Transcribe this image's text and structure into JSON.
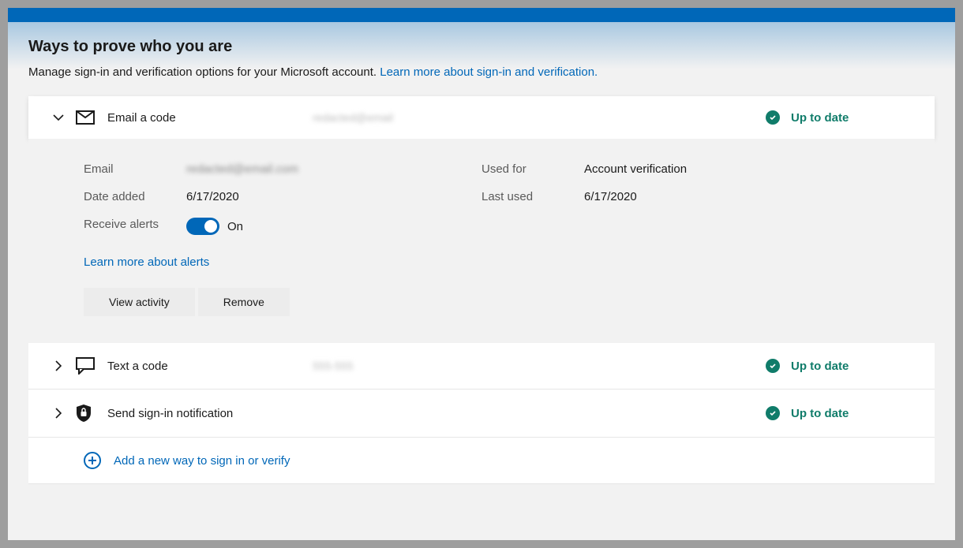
{
  "header": {
    "title": "Ways to prove who you are",
    "subtitle": "Manage sign-in and verification options for your Microsoft account. ",
    "learn_more": "Learn more about sign-in and verification."
  },
  "status_label": "Up to date",
  "methods": {
    "email": {
      "title": "Email a code",
      "detail_redacted": "redacted@email",
      "fields": {
        "email_label": "Email",
        "email_value": "redacted@email.com",
        "date_added_label": "Date added",
        "date_added_value": "6/17/2020",
        "receive_alerts_label": "Receive alerts",
        "receive_alerts_state": "On",
        "used_for_label": "Used for",
        "used_for_value": "Account verification",
        "last_used_label": "Last used",
        "last_used_value": "6/17/2020"
      },
      "alerts_link": "Learn more about alerts",
      "view_activity": "View activity",
      "remove": "Remove"
    },
    "text": {
      "title": "Text a code",
      "detail_redacted": "555-555"
    },
    "notification": {
      "title": "Send sign-in notification"
    }
  },
  "add_new": "Add a new way to sign in or verify"
}
